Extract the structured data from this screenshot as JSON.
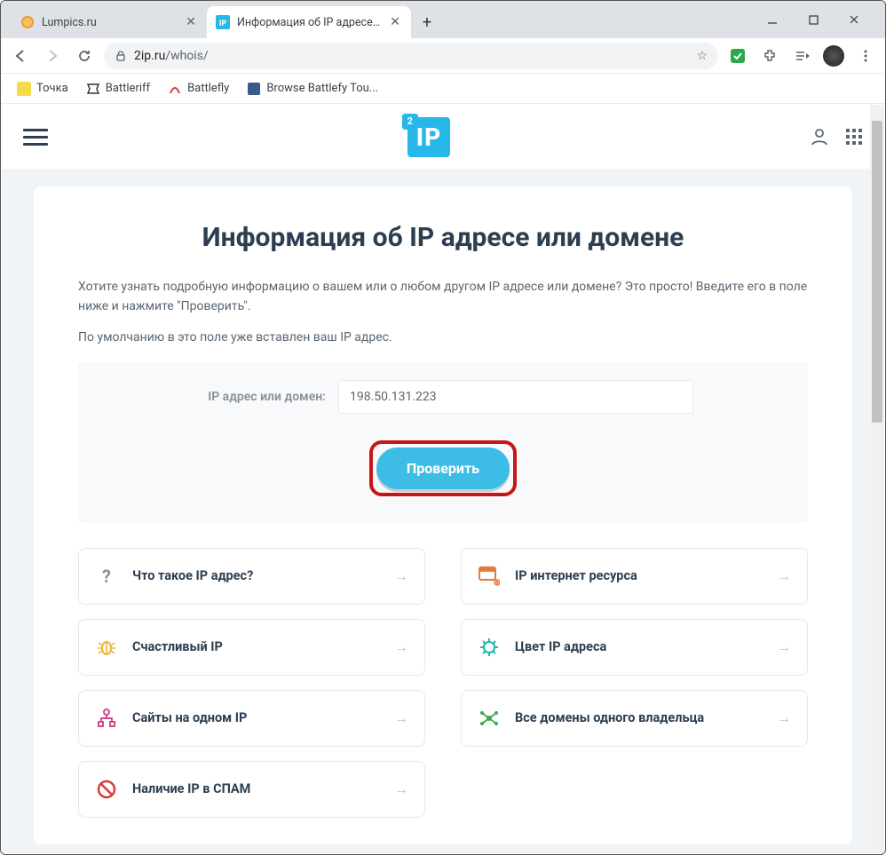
{
  "browser": {
    "tabs": [
      {
        "title": "Lumpics.ru",
        "active": false
      },
      {
        "title": "Информация об IP адресе или ",
        "active": true
      }
    ],
    "url_host": "2ip.ru",
    "url_path": "/whois/",
    "bookmarks": [
      {
        "label": "Точка"
      },
      {
        "label": "Battleriff"
      },
      {
        "label": "Battlefly"
      },
      {
        "label": "Browse Battlefy Tou..."
      }
    ]
  },
  "logo": {
    "sup": "2",
    "main": "IP"
  },
  "main": {
    "title": "Информация об IP адресе или домене",
    "desc1": "Хотите узнать подробную информацию о вашем или о любом другом IP адресе или домене? Это просто! Введите его в поле ниже и нажмите \"Проверить\".",
    "desc2": "По умолчанию в это поле уже вставлен ваш IP адрес.",
    "form": {
      "label": "IP адрес или домен:",
      "value": "198.50.131.223",
      "submit": "Проверить"
    },
    "links": [
      {
        "label": "Что такое IP адрес?",
        "icon": "question",
        "color": "#8a9098"
      },
      {
        "label": "IP интернет ресурса",
        "icon": "window",
        "color": "#e67a3c"
      },
      {
        "label": "Счастливый IP",
        "icon": "bug",
        "color": "#f2b33d"
      },
      {
        "label": "Цвет IP адреса",
        "icon": "virus",
        "color": "#1eb8a8"
      },
      {
        "label": "Сайты на одном IP",
        "icon": "tree",
        "color": "#d14a8c"
      },
      {
        "label": "Все домены одного владельца",
        "icon": "net",
        "color": "#3fa84f"
      },
      {
        "label": "Наличие IP в СПАМ",
        "icon": "ban",
        "color": "#d83a3a"
      }
    ]
  }
}
